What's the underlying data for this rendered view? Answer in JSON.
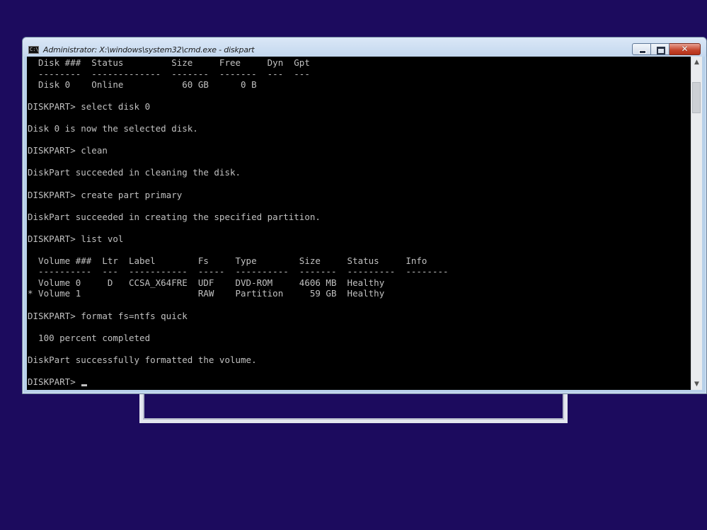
{
  "window": {
    "title": "Administrator: X:\\windows\\system32\\cmd.exe - diskpart",
    "icon_text": "C:\\",
    "minimize_icon": "minimize-icon",
    "maximize_icon": "maximize-icon",
    "close_icon": "close-icon",
    "close_glyph": "✕"
  },
  "console": {
    "lines": [
      "  Disk ###  Status         Size     Free     Dyn  Gpt",
      "  --------  -------------  -------  -------  ---  ---",
      "  Disk 0    Online           60 GB      0 B",
      "",
      "DISKPART> select disk 0",
      "",
      "Disk 0 is now the selected disk.",
      "",
      "DISKPART> clean",
      "",
      "DiskPart succeeded in cleaning the disk.",
      "",
      "DISKPART> create part primary",
      "",
      "DiskPart succeeded in creating the specified partition.",
      "",
      "DISKPART> list vol",
      "",
      "  Volume ###  Ltr  Label        Fs     Type        Size     Status     Info",
      "  ----------  ---  -----------  -----  ----------  -------  ---------  --------",
      "  Volume 0     D   CCSA_X64FRE  UDF    DVD-ROM     4606 MB  Healthy",
      "* Volume 1                      RAW    Partition     59 GB  Healthy",
      "",
      "DISKPART> format fs=ntfs quick",
      "",
      "  100 percent completed",
      "",
      "DiskPart successfully formatted the volume.",
      ""
    ],
    "prompt": "DISKPART> "
  },
  "scrollbar": {
    "up_arrow": "▲",
    "down_arrow": "▼"
  },
  "colors": {
    "desktop": "#1c0b5e",
    "console_bg": "#000000",
    "console_fg": "#c0c0c0",
    "close_button": "#c4442b"
  }
}
